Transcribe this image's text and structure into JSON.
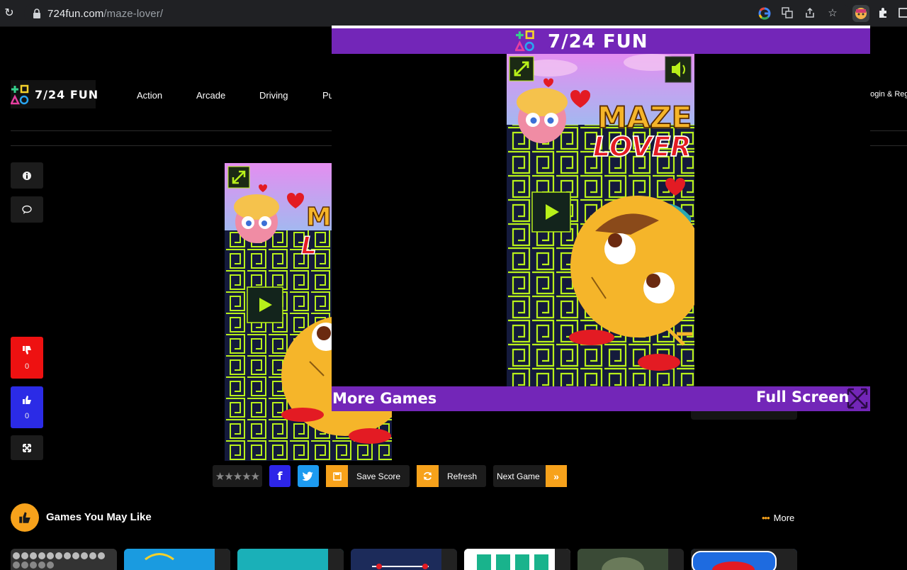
{
  "browser": {
    "url_domain": "724fun.com",
    "url_path": "/maze-lover/"
  },
  "site": {
    "logo_text": "7/24 FUN",
    "nav": [
      "Action",
      "Arcade",
      "Driving",
      "Pu"
    ],
    "login_text": "Login & Reg"
  },
  "sidebar": {
    "info_icon": "info-icon",
    "comment_icon": "comment-icon",
    "dislike_count": "0",
    "like_count": "0",
    "fullscreen_icon": "expand-icon"
  },
  "popup": {
    "title": "7/24 FUN",
    "more_games": "More Games",
    "full_screen": "Full Screen"
  },
  "game": {
    "title_line1": "MAZE",
    "title_line2": "LOVER"
  },
  "actions": {
    "stars": "★★★★★",
    "save_score": "Save Score",
    "refresh": "Refresh",
    "next_game": "Next Game"
  },
  "related": {
    "title": "Games You May Like",
    "more": "More"
  },
  "colors": {
    "purple": "#7326b8",
    "orange": "#f7a21b",
    "red": "#ee1111",
    "blue": "#2b2be6",
    "facebook": "#2d25e8",
    "twitter": "#1d9bf0"
  }
}
